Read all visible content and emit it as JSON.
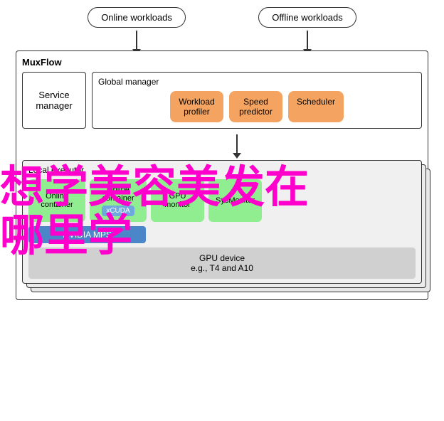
{
  "diagram": {
    "title": "MuxFlow",
    "topLabels": {
      "online": "Online workloads",
      "offline": "Offline workloads"
    },
    "serviceManager": {
      "label": "Service manager"
    },
    "globalManager": {
      "label": "Global manager",
      "items": [
        {
          "id": "workload-profiler",
          "label": "Workload\nprofiler"
        },
        {
          "id": "speed-predictor",
          "label": "Speed\npredictor"
        },
        {
          "id": "scheduler",
          "label": "Scheduler"
        }
      ]
    },
    "localExecutor": {
      "label": "Local executor",
      "containers": [
        {
          "id": "online-container-1",
          "label": "Online\ncontainer"
        },
        {
          "id": "online-container-2",
          "label": "Online\ncontainer",
          "badge": "xCUDA"
        },
        {
          "id": "gpu-monitor",
          "label": "GPU\nmonitor"
        },
        {
          "id": "sysmonitor",
          "label": "SysMonitor"
        }
      ],
      "nvidiaMps": "NVIDIA MPS",
      "gpuDevice": {
        "line1": "GPU device",
        "line2": "e.g., T4 and A10"
      }
    }
  },
  "overlay": {
    "text": "想学美容美发在哪里学",
    "color": "#ff00cc"
  }
}
